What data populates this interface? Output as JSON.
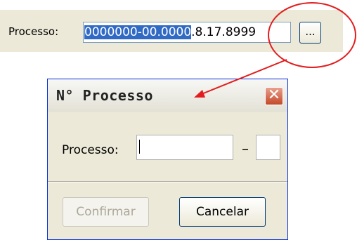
{
  "top_field": {
    "label": "Processo:",
    "value_selected": "0000000-00.0000",
    "value_rest": ".8.17.8999",
    "browse_label": "..."
  },
  "dialog": {
    "title": "N° Processo",
    "close_glyph": "✕",
    "processo_label": "Processo:",
    "processo_value": "",
    "dash": "–",
    "digit_value": "",
    "confirm_label": "Confirmar",
    "cancel_label": "Cancelar"
  },
  "colors": {
    "annotation": "#e31d1d",
    "selection": "#316ac5",
    "close_button": "#c4482a"
  }
}
